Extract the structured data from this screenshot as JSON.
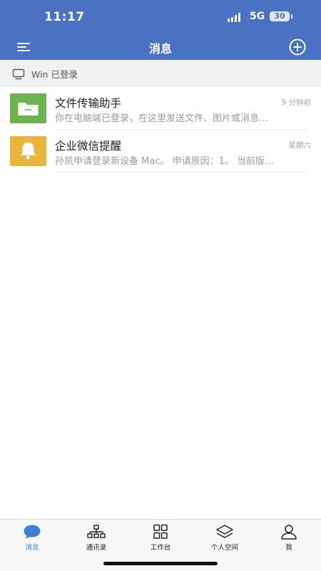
{
  "status_bar": {
    "time": "11:17",
    "network": "5G",
    "battery": "30"
  },
  "nav": {
    "title": "消息",
    "menu_icon": "menu-icon",
    "add_icon": "plus-circle-icon"
  },
  "login_banner": {
    "icon": "monitor-icon",
    "text": "Win 已登录"
  },
  "conversations": [
    {
      "name": "文件传输助手",
      "time": "9 分钟前",
      "preview": "你在电脑端已登录，在这里发送文件、图片或消息…",
      "icon": "folder-icon",
      "color": "#6db34f"
    },
    {
      "name": "企业微信提醒",
      "time": "星期六",
      "preview": "孙凯申请登录新设备 Mac。 申请原因：1。 当前版…",
      "icon": "bell-icon",
      "color": "#e9b53d"
    }
  ],
  "tabs": [
    {
      "label": "消息",
      "icon": "chat-bubble-icon",
      "active": true
    },
    {
      "label": "通讯录",
      "icon": "org-chart-icon",
      "active": false
    },
    {
      "label": "工作台",
      "icon": "grid-icon",
      "active": false
    },
    {
      "label": "个人空间",
      "icon": "layers-icon",
      "active": false
    },
    {
      "label": "我",
      "icon": "person-icon",
      "active": false
    }
  ],
  "colors": {
    "header": "#4a72c3",
    "active_tab": "#3d7dd9"
  }
}
